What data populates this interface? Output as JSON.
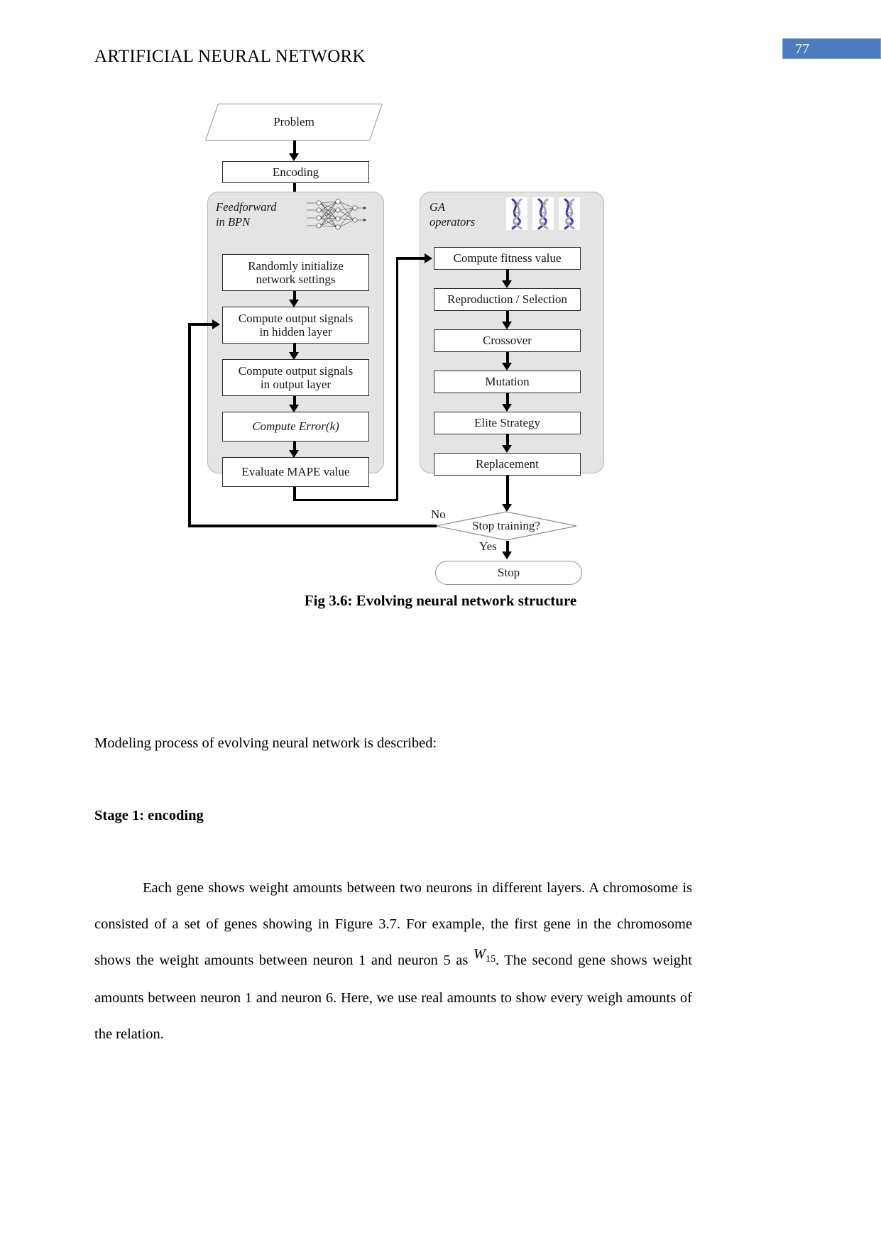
{
  "header": {
    "title": "ARTIFICIAL NEURAL NETWORK",
    "page_number": "77"
  },
  "figure": {
    "caption": "Fig 3.6: Evolving neural network structure",
    "start_node": "Problem",
    "encoding_node": "Encoding",
    "left_panel": {
      "title": "Feedforward\nin BPN",
      "icon": "neural-network-icon",
      "steps": [
        "Randomly initialize\nnetwork settings",
        "Compute output signals\nin hidden layer",
        "Compute output signals\nin output layer",
        "Compute Error(k)",
        "Evaluate MAPE value"
      ],
      "steps_line1": [
        "Randomly initialize",
        "Compute output signals",
        "Compute output signals",
        "Compute Error(k)",
        "Evaluate MAPE value"
      ],
      "steps_line2": [
        "network settings",
        "in hidden layer",
        "in output layer",
        "",
        ""
      ]
    },
    "right_panel": {
      "title": "GA\noperators",
      "icon": "dna-helix-icon",
      "steps": [
        "Compute fitness value",
        "Reproduction / Selection",
        "Crossover",
        "Mutation",
        "Elite Strategy",
        "Replacement"
      ]
    },
    "decision": "Stop training?",
    "edge_no": "No",
    "edge_yes": "Yes",
    "end_node": "Stop",
    "colors": {
      "panel_fill": "#e4e4e4",
      "panel_border": "#b6b6b6",
      "node_border": "#2b2b2b",
      "connector": "#000000"
    }
  },
  "body": {
    "intro": "Modeling process of evolving neural network is described:",
    "stage_heading": "Stage 1: encoding",
    "paragraph_part1": "Each gene shows weight amounts between two neurons in different layers. A chromosome is consisted of a set of genes showing in Figure 3.7. For example, the first gene in the chromosome shows the weight amounts between neuron 1 and neuron 5 as",
    "formula_symbol": "W",
    "formula_subscript": "15",
    "paragraph_part2": ". The second gene shows weight amounts between neuron 1 and neuron 6. Here, we use real amounts to show every weigh amounts of the relation."
  }
}
